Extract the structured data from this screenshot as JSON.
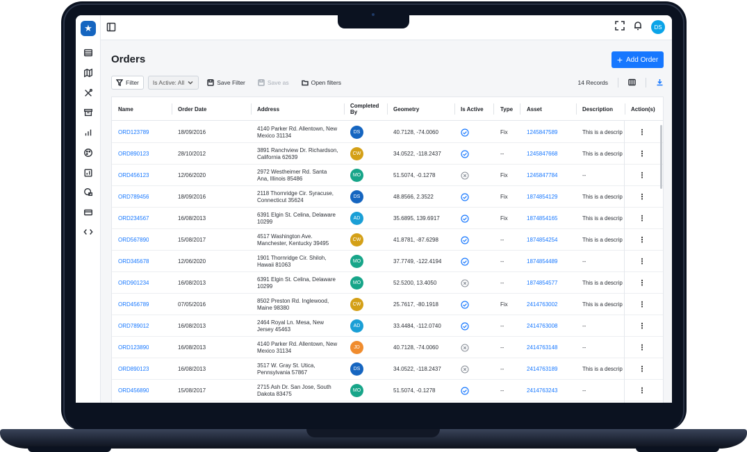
{
  "app": {
    "logo_glyph": "★"
  },
  "topbar": {
    "user_initials": "DS",
    "avatar_color": "#0aa4e8"
  },
  "sidebar": {
    "items": [
      {
        "name": "list-icon"
      },
      {
        "name": "map-icon"
      },
      {
        "name": "tools-icon"
      },
      {
        "name": "archive-icon"
      },
      {
        "name": "bar-chart-icon"
      },
      {
        "name": "palette-icon"
      },
      {
        "name": "report-icon"
      },
      {
        "name": "file-lock-icon"
      },
      {
        "name": "card-icon"
      },
      {
        "name": "code-icon"
      }
    ]
  },
  "page": {
    "title": "Orders",
    "add_button": "Add Order"
  },
  "toolbar": {
    "filter": "Filter",
    "is_active_filter": "Is Active: All",
    "save_filter": "Save Filter",
    "save_as": "Save as",
    "open_filters": "Open filters",
    "records": "14 Records"
  },
  "table": {
    "columns": [
      "Name",
      "Order Date",
      "Address",
      "Completed By",
      "Geometry",
      "Is Active",
      "Type",
      "Asset",
      "Description",
      "Action(s)"
    ],
    "rows": [
      {
        "name": "ORD123789",
        "date": "18/09/2016",
        "address": "4140 Parker Rd. Allentown, New Mexico 31134",
        "by": "DS",
        "by_color": "#1565c0",
        "geometry": "40.7128, -74.0060",
        "active": true,
        "type": "Fix",
        "asset": "1245847589",
        "desc": "This is a descrip",
        "action": "⋮"
      },
      {
        "name": "ORD890123",
        "date": "28/10/2012",
        "address": "3891 Ranchview Dr. Richardson, California 62639",
        "by": "CW",
        "by_color": "#d4a017",
        "geometry": "34.0522, -118.2437",
        "active": true,
        "type": "--",
        "asset": "1245847668",
        "desc": "This is a descrip",
        "action": "⋮"
      },
      {
        "name": "ORD456123",
        "date": "12/06/2020",
        "address": "2972 Westheimer Rd. Santa Ana, Illinois 85486",
        "by": "MO",
        "by_color": "#17a589",
        "geometry": "51.5074, -0.1278",
        "active": false,
        "type": "Fix",
        "asset": "1245847784",
        "desc": "--",
        "action": "⋮"
      },
      {
        "name": "ORD789456",
        "date": "18/09/2016",
        "address": "2118 Thornridge Cir. Syracuse, Connecticut 35624",
        "by": "DS",
        "by_color": "#1565c0",
        "geometry": "48.8566, 2.3522",
        "active": true,
        "type": "Fix",
        "asset": "1874854129",
        "desc": "This is a descrip",
        "action": "⋮"
      },
      {
        "name": "ORD234567",
        "date": "16/08/2013",
        "address": "6391 Elgin St. Celina, Delaware 10299",
        "by": "AD",
        "by_color": "#1a9fd6",
        "geometry": "35.6895, 139.6917",
        "active": true,
        "type": "Fix",
        "asset": "1874854165",
        "desc": "This is a descrip",
        "action": "⋮"
      },
      {
        "name": "ORD567890",
        "date": "15/08/2017",
        "address": "4517 Washington Ave. Manchester, Kentucky 39495",
        "by": "CW",
        "by_color": "#d4a017",
        "geometry": "41.8781, -87.6298",
        "active": true,
        "type": "--",
        "asset": "1874854254",
        "desc": "This is a descrip",
        "action": "⋮"
      },
      {
        "name": "ORD345678",
        "date": "12/06/2020",
        "address": "1901 Thornridge Cir. Shiloh, Hawaii 81063",
        "by": "MO",
        "by_color": "#17a589",
        "geometry": "37.7749, -122.4194",
        "active": true,
        "type": "--",
        "asset": "1874854489",
        "desc": "--",
        "action": "⋮"
      },
      {
        "name": "ORD901234",
        "date": "16/08/2013",
        "address": "6391 Elgin St. Celina, Delaware 10299",
        "by": "MO",
        "by_color": "#17a589",
        "geometry": "52.5200, 13.4050",
        "active": false,
        "type": "--",
        "asset": "1874854577",
        "desc": "This is a descrip",
        "action": "⋮"
      },
      {
        "name": "ORD456789",
        "date": "07/05/2016",
        "address": "8502 Preston Rd. Inglewood, Maine 98380",
        "by": "CW",
        "by_color": "#d4a017",
        "geometry": "25.7617, -80.1918",
        "active": true,
        "type": "Fix",
        "asset": "2414763002",
        "desc": "This is a descrip",
        "action": "⋮"
      },
      {
        "name": "ORD789012",
        "date": "16/08/2013",
        "address": "2464 Royal Ln. Mesa, New Jersey 45463",
        "by": "AD",
        "by_color": "#1a9fd6",
        "geometry": "33.4484, -112.0740",
        "active": true,
        "type": "--",
        "asset": "2414763008",
        "desc": "--",
        "action": "⋮"
      },
      {
        "name": "ORD123890",
        "date": "16/08/2013",
        "address": "4140 Parker Rd. Allentown, New Mexico 31134",
        "by": "JD",
        "by_color": "#f08c2e",
        "geometry": "40.7128, -74.0060",
        "active": false,
        "type": "--",
        "asset": "2414763148",
        "desc": "--",
        "action": "⋮"
      },
      {
        "name": "ORD890123",
        "date": "16/08/2013",
        "address": "3517 W. Gray St. Utica, Pennsylvania 57867",
        "by": "DS",
        "by_color": "#1565c0",
        "geometry": "34.0522, -118.2437",
        "active": false,
        "type": "--",
        "asset": "2414763189",
        "desc": "This is a descrip",
        "action": "⋮"
      },
      {
        "name": "ORD456890",
        "date": "15/08/2017",
        "address": "2715 Ash Dr. San Jose, South Dakota 83475",
        "by": "MO",
        "by_color": "#17a589",
        "geometry": "51.5074, -0.1278",
        "active": true,
        "type": "--",
        "asset": "2414763243",
        "desc": "--",
        "action": "⋮"
      }
    ]
  },
  "colors": {
    "accent": "#1677ff",
    "active_check": "#1677ff",
    "inactive": "#8a9099"
  }
}
